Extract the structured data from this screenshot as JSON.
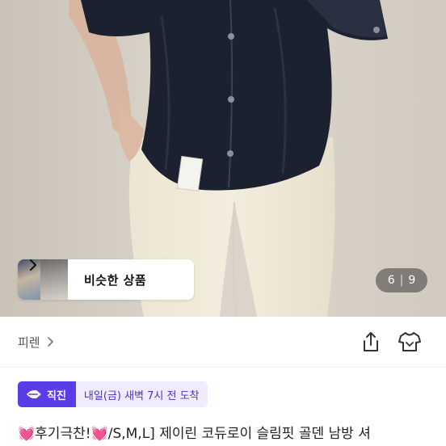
{
  "photo": {
    "similar_products": {
      "label": "비슷한 상품"
    },
    "counter": {
      "current": "6",
      "separator": "|",
      "total": "9"
    }
  },
  "shop": {
    "name": "피렌"
  },
  "icons": [
    "chevron-right-icon",
    "share-icon",
    "tshirt-icon",
    "bolt-icon",
    "heart-icon"
  ],
  "delivery": {
    "badge_label": "직진",
    "eta_text": "내일(금) 새벽 7시 전 도착"
  },
  "product": {
    "heart_emoji": "💓",
    "title_part1": "후기극찬!",
    "title_part2": "/S,M,L] 제이린 코듀로이 슬림핏 골덴 남방 셔"
  },
  "colors": {
    "accent": "#5b3de8",
    "accent_light": "#f0ecfd",
    "heart": "#ff4fa3"
  }
}
